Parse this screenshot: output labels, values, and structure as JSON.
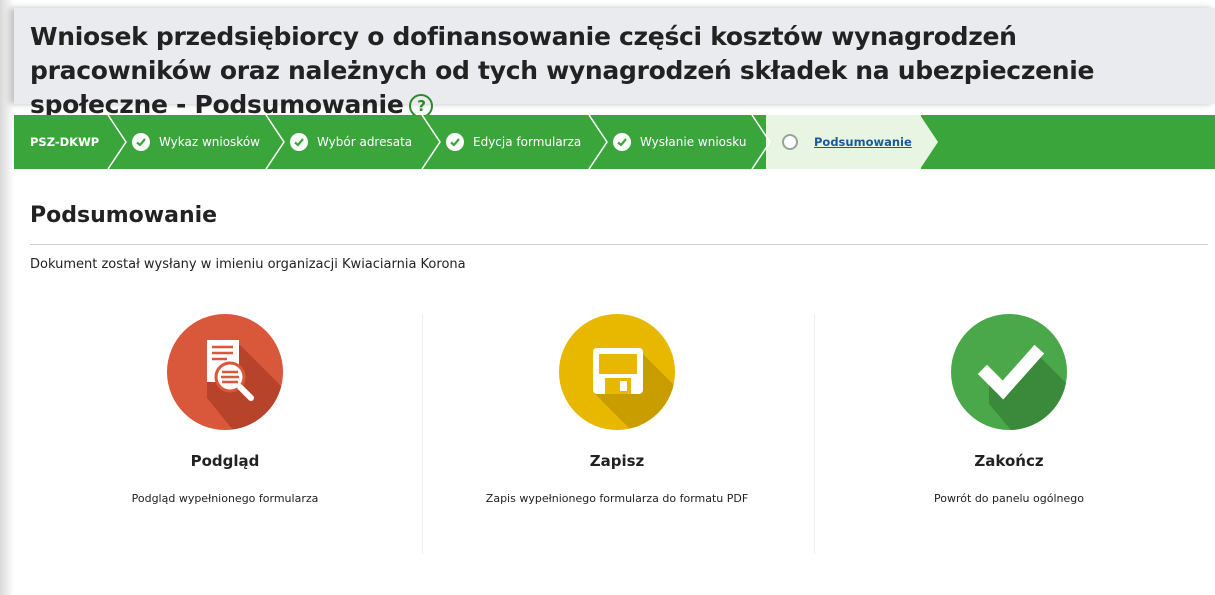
{
  "header": {
    "title": "Wniosek przedsiębiorcy o dofinansowanie części kosztów wynagrodzeń pracowników oraz należnych od tych wynagrodzeń składek na ubezpieczenie społeczne - Podsumowanie",
    "help_icon": "question-circle-icon"
  },
  "breadcrumb": {
    "root": "PSZ-DKWP",
    "steps": [
      {
        "label": "Wykaz wniosków",
        "state": "done"
      },
      {
        "label": "Wybór adresata",
        "state": "done"
      },
      {
        "label": "Edycja formularza",
        "state": "done"
      },
      {
        "label": "Wysłanie wniosku",
        "state": "done"
      },
      {
        "label": "Podsumowanie",
        "state": "current"
      }
    ]
  },
  "main": {
    "title": "Podsumowanie",
    "info": "Dokument został wysłany w imieniu organizacji Kwiaciarnia Korona",
    "actions": [
      {
        "title": "Podgląd",
        "description": "Podgląd wypełnionego formularza",
        "icon": "document-magnifier-icon",
        "color": "#d9573a"
      },
      {
        "title": "Zapisz",
        "description": "Zapis wypełnionego formularza do formatu PDF",
        "icon": "floppy-disk-icon",
        "color": "#e8b800"
      },
      {
        "title": "Zakończ",
        "description": "Powrót do panelu ogólnego",
        "icon": "checkmark-icon",
        "color": "#4aa84a"
      }
    ]
  },
  "colors": {
    "breadcrumb_bg": "#3aa53b",
    "active_step_bg": "#e8f5e3",
    "header_bg": "#e9ebee"
  }
}
